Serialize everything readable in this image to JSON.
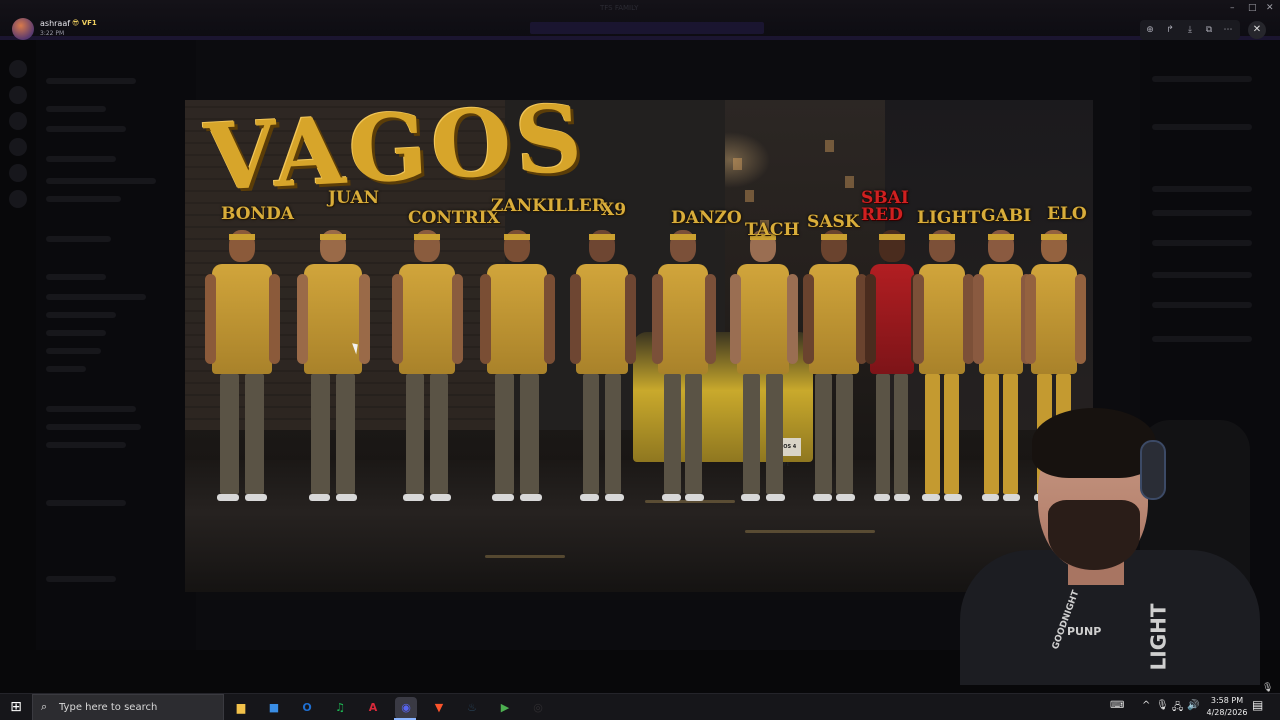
{
  "window": {
    "title": "TFS FAMILY",
    "controls": {
      "minimize": "–",
      "maximize": "□",
      "close": "✕"
    }
  },
  "viewer": {
    "user": "ashraaf",
    "badge": "😎 VF1",
    "timestamp": "3:22 PM",
    "tools": [
      "zoom-in-icon",
      "share-icon",
      "download-icon",
      "open-external-icon",
      "more-icon"
    ],
    "close_label": "✕"
  },
  "poster": {
    "title": "VAGOS",
    "plate": "VAGOS 4 LIFE",
    "members": [
      {
        "name": "BONDA",
        "color": "#d9ad3a"
      },
      {
        "name": "JUAN",
        "color": "#d9ad3a"
      },
      {
        "name": "CONTRIX",
        "color": "#d9ad3a"
      },
      {
        "name": "ZANKILLER",
        "color": "#d9ad3a"
      },
      {
        "name": "X9",
        "color": "#d9ad3a"
      },
      {
        "name": "DANZO",
        "color": "#d9ad3a"
      },
      {
        "name": "TACH",
        "color": "#d9ad3a"
      },
      {
        "name": "SASK",
        "color": "#d9ad3a"
      },
      {
        "name": "SBAI RED",
        "color": "#d02020"
      },
      {
        "name": "LIGHT",
        "color": "#d9ad3a"
      },
      {
        "name": "GABI",
        "color": "#d9ad3a"
      },
      {
        "name": "ELO",
        "color": "#d9ad3a"
      }
    ]
  },
  "webcam": {
    "shirt_text": [
      "GOODNIGHT",
      "PUNP",
      "LIGHT"
    ]
  },
  "taskbar": {
    "start_icon": "windows-icon",
    "search_placeholder": "Type here to search",
    "apps": [
      {
        "name": "file-explorer",
        "glyph": "▆",
        "color": "#f2c14a"
      },
      {
        "name": "microsoft-store",
        "glyph": "■",
        "color": "#3a8ee6"
      },
      {
        "name": "outlook",
        "glyph": "O",
        "color": "#1f6fd1"
      },
      {
        "name": "spotify",
        "glyph": "♫",
        "color": "#1db954"
      },
      {
        "name": "adobe-app",
        "glyph": "A",
        "color": "#d8293a"
      },
      {
        "name": "discord",
        "glyph": "◉",
        "color": "#5865f2"
      },
      {
        "name": "brave",
        "glyph": "▼",
        "color": "#fb542b"
      },
      {
        "name": "steam",
        "glyph": "♨",
        "color": "#2a475e"
      },
      {
        "name": "media-player",
        "glyph": "▶",
        "color": "#4caf50"
      },
      {
        "name": "obs",
        "glyph": "◎",
        "color": "#302e31"
      }
    ],
    "tray": [
      "^",
      "🎙",
      "🖧",
      "🔊"
    ],
    "time": "3:58 PM",
    "date": "4/28/2026"
  }
}
